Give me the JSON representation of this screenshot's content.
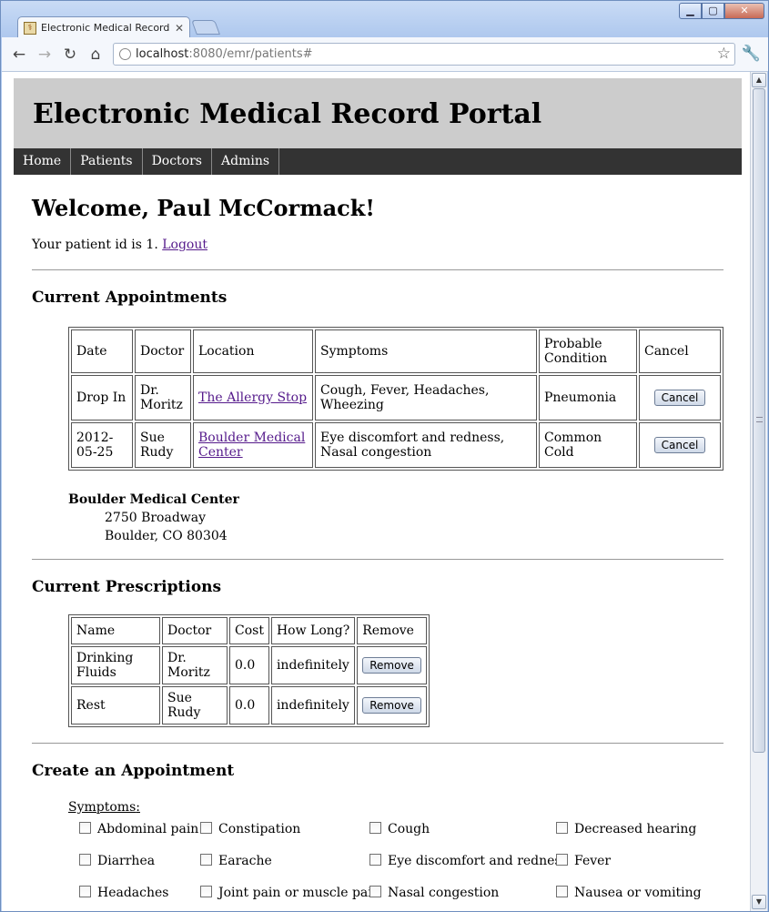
{
  "browser": {
    "tab_title": "Electronic Medical Record Port",
    "url_host": "localhost",
    "url_rest": ":8080/emr/patients#",
    "win_min": "▁",
    "win_max": "▢",
    "win_close": "✕"
  },
  "header": {
    "title": "Electronic Medical Record Portal"
  },
  "nav": [
    "Home",
    "Patients",
    "Doctors",
    "Admins"
  ],
  "welcome": {
    "heading": "Welcome, Paul McCormack!",
    "id_text": "Your patient id is 1.",
    "logout": "Logout"
  },
  "appointments": {
    "heading": "Current Appointments",
    "headers": [
      "Date",
      "Doctor",
      "Location",
      "Symptoms",
      "Probable Condition",
      "Cancel"
    ],
    "rows": [
      {
        "date": "Drop In",
        "doctor": "Dr. Moritz",
        "location": "The Allergy Stop",
        "symptoms": "Cough, Fever, Headaches, Wheezing",
        "condition": "Pneumonia",
        "action": "Cancel"
      },
      {
        "date": "2012-05-25",
        "doctor": "Sue Rudy",
        "location": "Boulder Medical Center",
        "symptoms": "Eye discomfort and redness, Nasal congestion",
        "condition": "Common Cold",
        "action": "Cancel"
      }
    ]
  },
  "location_detail": {
    "name": "Boulder Medical Center",
    "street": "2750 Broadway",
    "city": "Boulder, CO 80304"
  },
  "prescriptions": {
    "heading": "Current Prescriptions",
    "headers": [
      "Name",
      "Doctor",
      "Cost",
      "How Long?",
      "Remove"
    ],
    "rows": [
      {
        "name": "Drinking Fluids",
        "doctor": "Dr. Moritz",
        "cost": "0.0",
        "duration": "indefinitely",
        "action": "Remove"
      },
      {
        "name": "Rest",
        "doctor": "Sue Rudy",
        "cost": "0.0",
        "duration": "indefinitely",
        "action": "Remove"
      }
    ]
  },
  "create": {
    "heading": "Create an Appointment",
    "symptoms_label": "Symptoms",
    "symptoms": [
      "Abdominal pain",
      "Constipation",
      "Cough",
      "Decreased hearing",
      "Diarrhea",
      "Earache",
      "Eye discomfort and redness",
      "Fever",
      "Headaches",
      "Joint pain or muscle pain",
      "Nasal congestion",
      "Nausea or vomiting"
    ]
  }
}
